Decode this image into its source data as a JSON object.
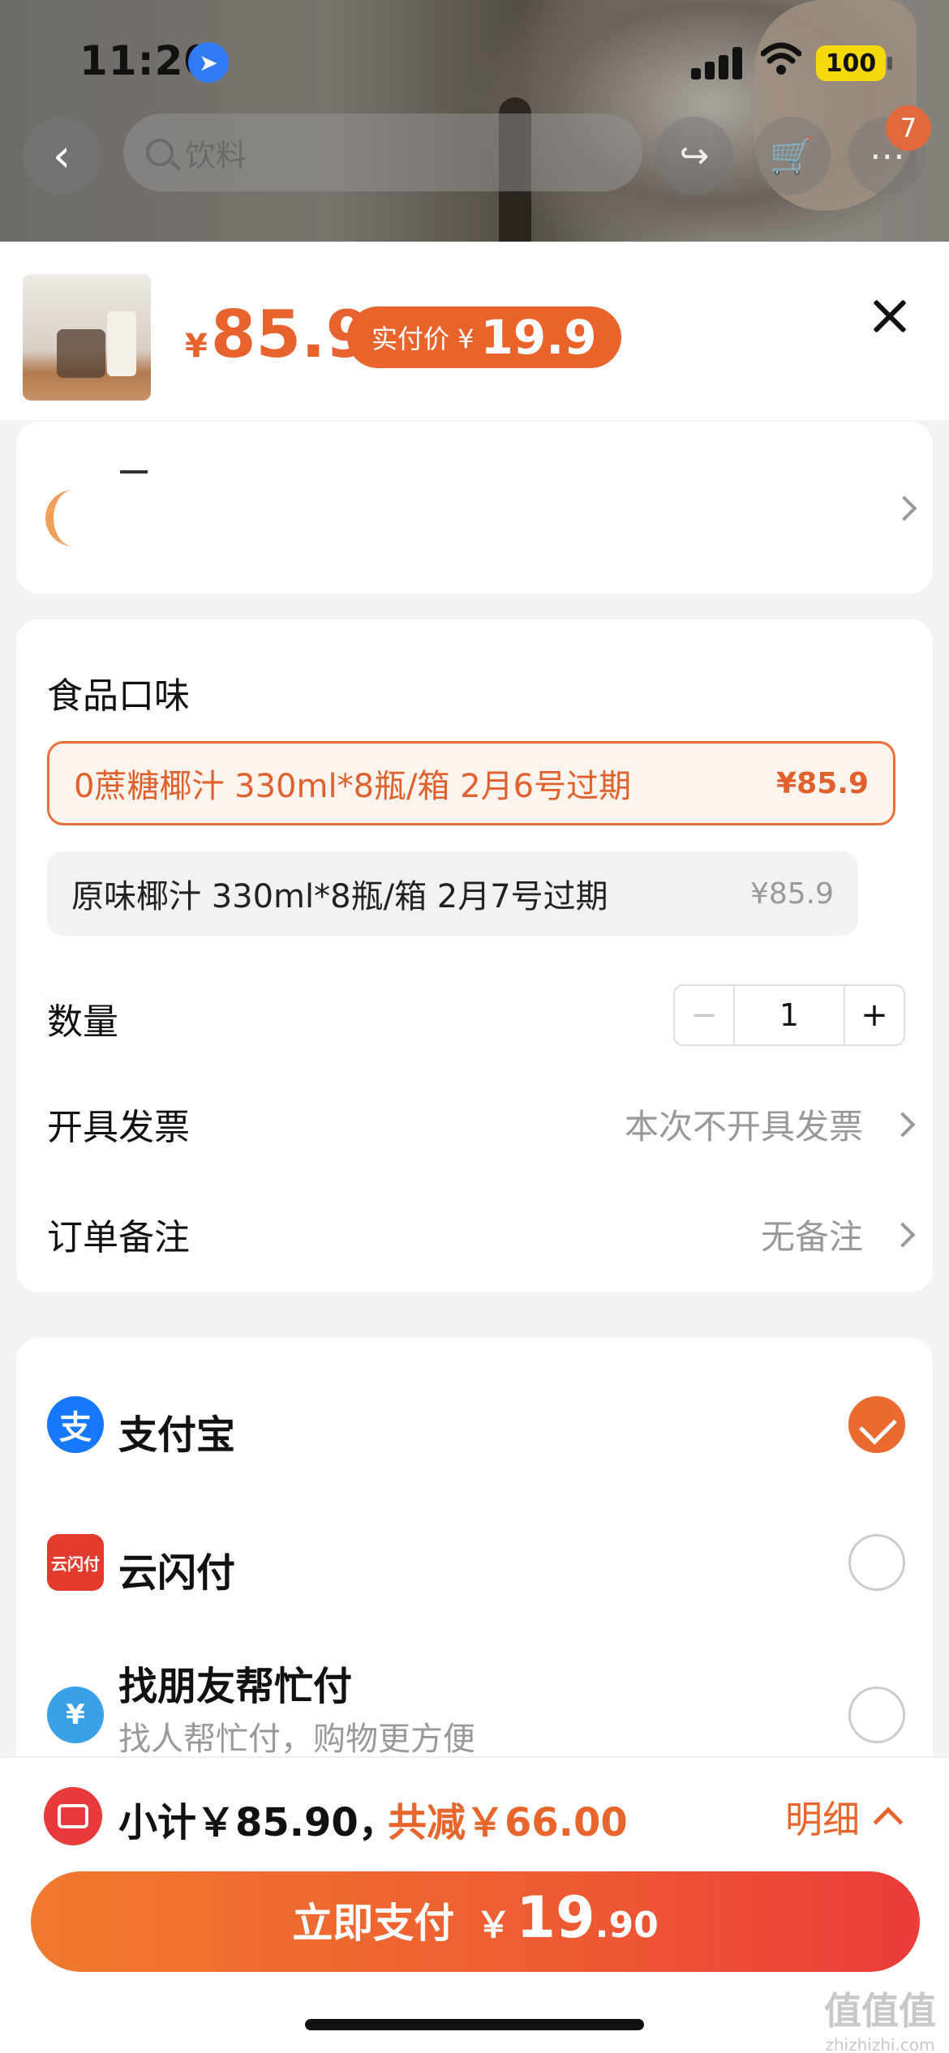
{
  "status_bar": {
    "time": "11:20",
    "battery": "100"
  },
  "nav": {
    "search_placeholder": "饮料",
    "cart_badge": "7"
  },
  "product": {
    "price_symbol": "¥",
    "price": "85.9",
    "real_price_label": "实付价 ¥",
    "real_price": "19.9"
  },
  "spec": {
    "title": "食品口味",
    "options": [
      {
        "label": "0蔗糖椰汁 330ml*8瓶/箱  2月6号过期",
        "price": "¥85.9",
        "selected": true
      },
      {
        "label": "原味椰汁 330ml*8瓶/箱 2月7号过期",
        "price": "¥85.9",
        "selected": false
      }
    ],
    "quantity_label": "数量",
    "quantity": "1",
    "minus": "−",
    "plus": "+",
    "invoice_label": "开具发票",
    "invoice_value": "本次不开具发票",
    "remark_label": "订单备注",
    "remark_value": "无备注"
  },
  "payment": {
    "methods": [
      {
        "name": "支付宝",
        "icon": "alipay-icon",
        "selected": true
      },
      {
        "name": "云闪付",
        "icon": "unionpay-icon",
        "selected": false
      },
      {
        "name": "找朋友帮忙付",
        "sub": "找人帮忙付，购物更方便",
        "icon": "friend-pay-icon",
        "selected": false
      }
    ]
  },
  "footer": {
    "subtotal": "小计￥85.90，",
    "discount": "共减￥66.00",
    "detail": "明细",
    "pay_label": "立即支付",
    "pay_symbol": "￥",
    "pay_int": "19",
    "pay_dec": ".90"
  },
  "watermark": {
    "line1": "值值值",
    "line2": "zhizhizhi.com"
  },
  "colors": {
    "accent": "#e8662c",
    "alipay": "#1677ff",
    "unionpay": "#e23b2e",
    "friendpay": "#3aa0e8"
  }
}
